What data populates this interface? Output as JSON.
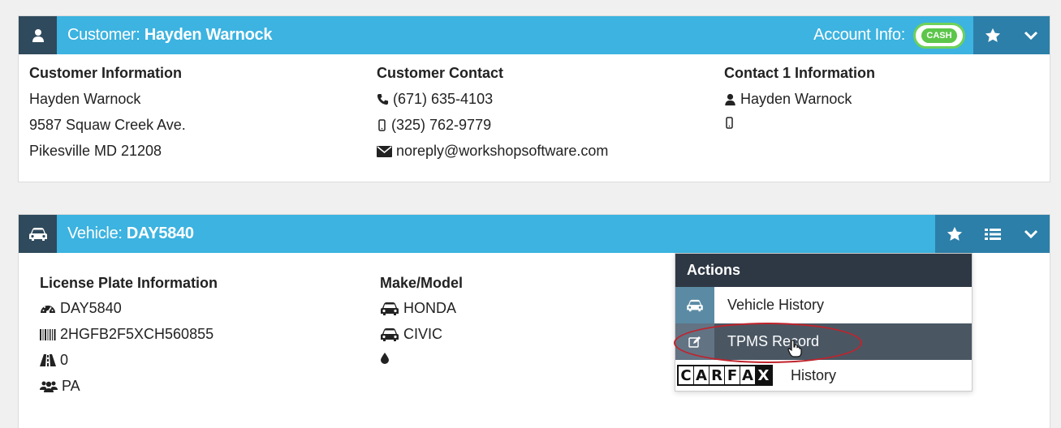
{
  "customer_panel": {
    "title_prefix": "Customer: ",
    "title_name": "Hayden Warnock",
    "account_label": "Account Info:",
    "cash_badge": "CASH",
    "icons": {
      "header": "user-icon",
      "star": "star-icon",
      "collapse": "chevron-down-icon"
    },
    "info": {
      "title": "Customer Information",
      "name": "Hayden Warnock",
      "street": "9587 Squaw Creek Ave.",
      "city": "Pikesville MD 21208"
    },
    "contact": {
      "title": "Customer Contact",
      "phone": "(671) 635-4103",
      "mobile": "(325) 762-9779",
      "email": "noreply@workshopsoftware.com"
    },
    "contact1": {
      "title": "Contact 1 Information",
      "name": "Hayden Warnock",
      "mobile": ""
    }
  },
  "vehicle_panel": {
    "title_prefix": "Vehicle: ",
    "title_plate": "DAY5840",
    "icons": {
      "header": "car-icon",
      "star": "star-icon",
      "list": "list-icon",
      "collapse": "chevron-down-icon"
    },
    "plate_info": {
      "title": "License Plate Information",
      "plate": "DAY5840",
      "vin": "2HGFB2F5XCH560855",
      "odometer": "0",
      "state": "PA"
    },
    "make_model": {
      "title": "Make/Model",
      "make": "HONDA",
      "model": "CIVIC",
      "fuel": ""
    }
  },
  "actions_menu": {
    "title": "Actions",
    "items": [
      {
        "label": "Vehicle History",
        "icon": "car-icon"
      },
      {
        "label": "TPMS Record",
        "icon": "edit-icon"
      },
      {
        "label": "History",
        "icon": "carfax-logo"
      }
    ],
    "carfax_letters": [
      "C",
      "A",
      "R",
      "F",
      "A",
      "X"
    ]
  },
  "colors": {
    "header_blue": "#3cb3e0",
    "header_dark": "#2f4a5c",
    "cash_green": "#5cc64a",
    "highlight_red": "#c0232c"
  }
}
